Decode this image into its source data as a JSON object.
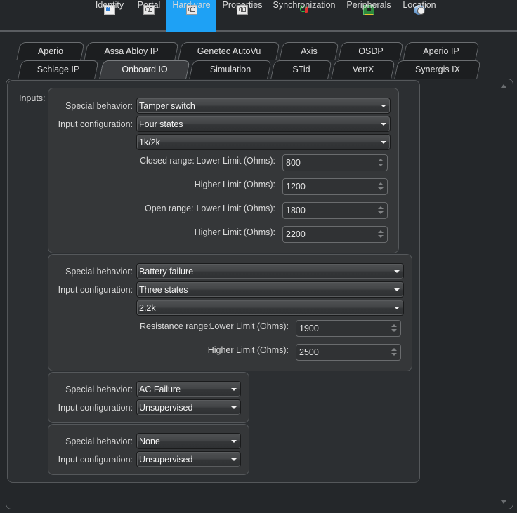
{
  "top_tabs": [
    {
      "label": "Identity",
      "icon": "identity-card-icon",
      "active": false
    },
    {
      "label": "Portal",
      "icon": "portal-icon",
      "active": false
    },
    {
      "label": "Hardware",
      "icon": "hardware-icon",
      "active": true
    },
    {
      "label": "Properties",
      "icon": "properties-icon",
      "active": false
    },
    {
      "label": "Synchronization",
      "icon": "sync-arrows-icon",
      "active": false
    },
    {
      "label": "Peripherals",
      "icon": "circuit-board-icon",
      "active": false
    },
    {
      "label": "Location",
      "icon": "globe-clock-icon",
      "active": false
    }
  ],
  "sub_tabs_row1": [
    "Aperio",
    "Assa Abloy IP",
    "Genetec AutoVu",
    "Axis",
    "OSDP",
    "Aperio IP"
  ],
  "sub_tabs_row2": [
    "Schlage IP",
    "Onboard IO",
    "Simulation",
    "STid",
    "VertX",
    "Synergis IX"
  ],
  "active_sub_tab": "Onboard IO",
  "inputs_label": "Inputs:",
  "labels": {
    "special_behavior": "Special behavior:",
    "input_configuration": "Input configuration:",
    "closed_range": "Closed range:",
    "open_range": "Open range:",
    "resistance_range": "Resistance range:",
    "lower_limit": "Lower Limit (Ohms):",
    "higher_limit": "Higher Limit (Ohms):"
  },
  "inputs": [
    {
      "special_behavior": "Tamper switch",
      "input_configuration": "Four states",
      "resistor": "1k/2k",
      "closed_lower": "800",
      "closed_higher": "1200",
      "open_lower": "1800",
      "open_higher": "2200"
    },
    {
      "special_behavior": "Battery failure",
      "input_configuration": "Three states",
      "resistor": "2.2k",
      "resistance_lower": "1900",
      "resistance_higher": "2500"
    },
    {
      "special_behavior": "AC Failure",
      "input_configuration": "Unsupervised"
    },
    {
      "special_behavior": "None",
      "input_configuration": "Unsupervised"
    }
  ]
}
